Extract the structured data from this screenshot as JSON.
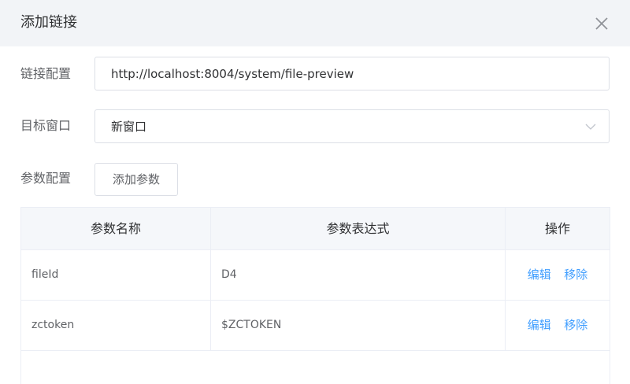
{
  "dialog": {
    "title": "添加链接",
    "close_icon": "close-icon"
  },
  "form": {
    "link_label": "链接配置",
    "link_value": "http://localhost:8004/system/file-preview",
    "target_label": "目标窗口",
    "target_value": "新窗口",
    "params_label": "参数配置",
    "add_param_label": "添加参数"
  },
  "table": {
    "headers": [
      "参数名称",
      "参数表达式",
      "操作"
    ],
    "rows": [
      {
        "name": "fileId",
        "expression": "D4",
        "edit": "编辑",
        "remove": "移除"
      },
      {
        "name": "zctoken",
        "expression": "$ZCTOKEN",
        "edit": "编辑",
        "remove": "移除"
      }
    ]
  },
  "colors": {
    "header_bg": "#f2f4f7",
    "table_header_bg": "#f5f7fa",
    "link": "#409eff",
    "border": "#dcdfe6"
  }
}
